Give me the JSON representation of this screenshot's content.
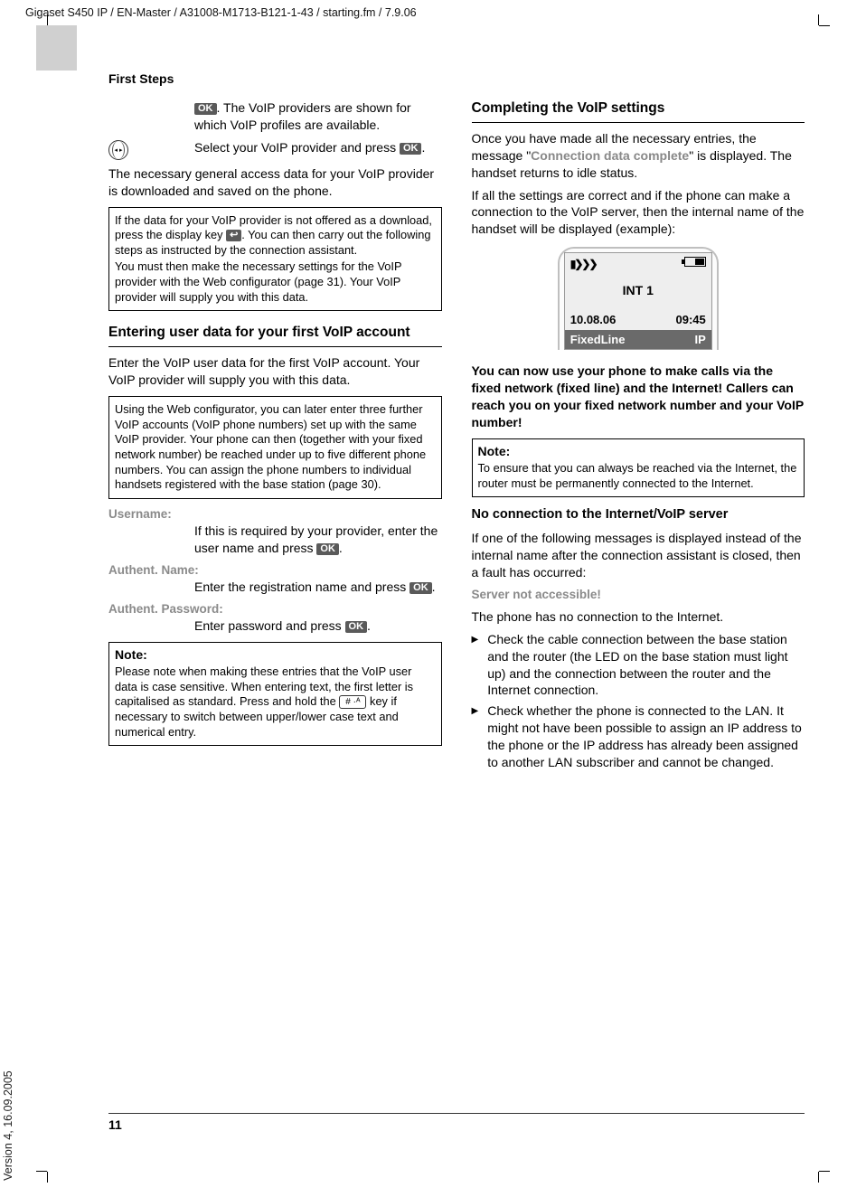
{
  "header_path": "Gigaset S450 IP / EN-Master / A31008-M1713-B121-1-43 / starting.fm / 7.9.06",
  "section": "First Steps",
  "version": "Version 4, 16.09.2005",
  "page": "11",
  "left": {
    "p1_a": ". The VoIP providers are shown for which VoIP profiles are available.",
    "p2": "Select your VoIP provider and press ",
    "p3": "The necessary general access data for your VoIP provider is downloaded and saved on the phone.",
    "box1_a": "If the data for your VoIP provider is not offered as a download, press the display key ",
    "box1_b": ". You can then carry out the following steps as instructed by the connection assistant.",
    "box1_c": "You must then make the necessary settings for the VoIP provider with the Web configurator (page 31). Your VoIP provider will supply you with this data.",
    "h2": "Entering user data for your first VoIP account",
    "p4": "Enter the VoIP user data for the first VoIP account. Your VoIP provider will supply you with this data.",
    "box2": "Using the Web configurator, you can later enter three further VoIP accounts (VoIP phone numbers) set up with the same VoIP provider. Your phone can then (together with your fixed network number) be reached under up to five different phone numbers. You can assign the phone numbers to individual handsets registered with the base station (page 30).",
    "username_label": "Username:",
    "username_text": "If this is required by your provider, enter the user name and press ",
    "authname_label": "Authent. Name:",
    "authname_text": "Enter the registration name and press ",
    "authpass_label": "Authent. Password:",
    "authpass_text": "Enter password and press ",
    "note_title": "Note:",
    "note_text_a": "Please note when making these entries that the VoIP user data is case sensitive. When entering text, the first letter is capitalised as standard. Press and hold the ",
    "note_text_b": " key if necessary to switch between upper/lower case text and numerical entry."
  },
  "right": {
    "h2": "Completing the VoIP settings",
    "p1_a": "Once you have made all the necessary entries, the message \"",
    "p1_grey": "Connection data complete",
    "p1_b": "\" is displayed. The handset returns to idle status.",
    "p2": "If all the settings are correct and if the phone can make a connection to the VoIP server, then the internal name of the handset will be displayed (example):",
    "screen": {
      "name": "INT 1",
      "date": "10.08.06",
      "time": "09:45",
      "soft_left": "FixedLine",
      "soft_right": "IP"
    },
    "bold": "You can now use your phone to make calls via the fixed network (fixed line) and the Internet! Callers can reach you on your fixed network number and your VoIP number!",
    "note_title": "Note:",
    "note_text": "To ensure that you can always be reached via the Internet, the router must be permanently connected to the Internet.",
    "h3": "No connection to the Internet/VoIP server",
    "p3": "If one of the following messages is displayed instead of the internal name after the connection assistant is closed, then a fault has occurred:",
    "err": "Server not accessible!",
    "p4": "The phone has no connection to the Internet.",
    "bullet1": "Check the cable connection between the base station and the router (the LED on the base station must light up) and the connection between the router and the Internet connection.",
    "bullet2": "Check whether the phone is connected to the LAN. It might not have been possible to assign an IP address to the phone or the IP address has already been assigned to another LAN subscriber and cannot be changed."
  },
  "keys": {
    "ok": "OK",
    "back": "↩",
    "hash": "# ·ᴬ"
  }
}
